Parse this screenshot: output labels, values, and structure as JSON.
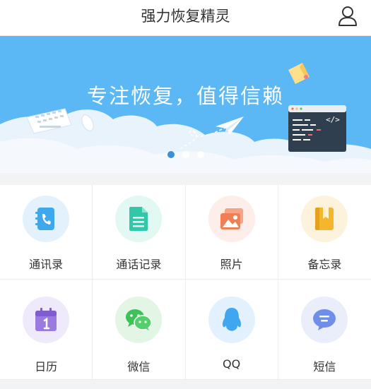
{
  "header": {
    "title": "强力恢复精灵",
    "user_icon": "user-icon"
  },
  "banner": {
    "slogan": "专注恢复，值得信赖",
    "slide_count": 3,
    "active_slide": 1,
    "code_tag": "</>"
  },
  "features": [
    {
      "label": "通讯录",
      "icon": "contacts-icon",
      "bg": "#e3f1fd",
      "color": "#3ea7ee"
    },
    {
      "label": "通话记录",
      "icon": "call-log-icon",
      "bg": "#e1f8f3",
      "color": "#33c7aa"
    },
    {
      "label": "照片",
      "icon": "photo-icon",
      "bg": "#fdeeea",
      "color": "#f07f55"
    },
    {
      "label": "备忘录",
      "icon": "memo-icon",
      "bg": "#fdf3dc",
      "color": "#f4b62f"
    },
    {
      "label": "日历",
      "icon": "calendar-icon",
      "bg": "#efeafb",
      "color": "#9a79e0"
    },
    {
      "label": "微信",
      "icon": "wechat-icon",
      "bg": "#e3f6e5",
      "color": "#3fc15a"
    },
    {
      "label": "QQ",
      "icon": "qq-icon",
      "bg": "#e2f1fd",
      "color": "#3fa6ef"
    },
    {
      "label": "短信",
      "icon": "sms-icon",
      "bg": "#eaeefb",
      "color": "#6f8ee8"
    }
  ]
}
